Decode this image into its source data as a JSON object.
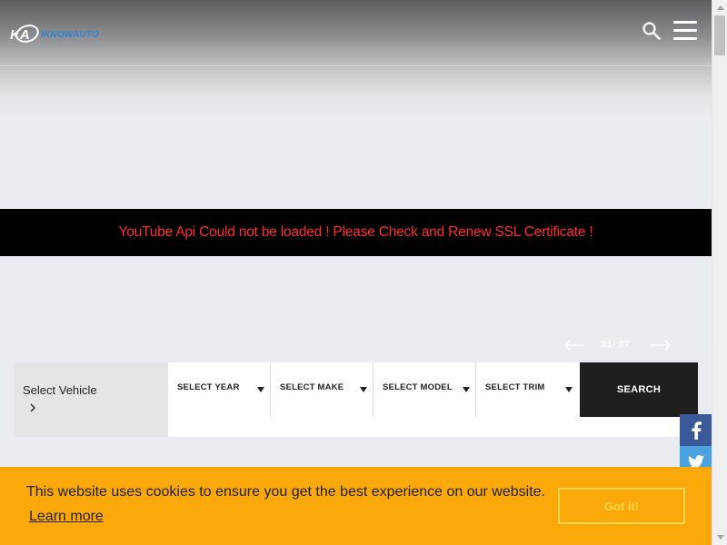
{
  "header": {
    "logo_text": "IKNOWAUTO",
    "logo_mark_icon": "ka-logo-icon",
    "search_icon": "search-icon",
    "menu_icon": "hamburger-menu-icon"
  },
  "banner": {
    "message": "YouTube Api Could not be loaded ! Please Check and Renew SSL Certificate !"
  },
  "pager": {
    "count": "01- 07",
    "prev_icon": "arrow-left-icon",
    "next_icon": "arrow-right-icon"
  },
  "vehicle_search": {
    "label": "Select Vehicle",
    "chevron_icon": "chevron-right-icon",
    "selects": [
      {
        "label": "SELECT YEAR"
      },
      {
        "label": "SELECT MAKE"
      },
      {
        "label": "SELECT MODEL"
      },
      {
        "label": "SELECT TRIM"
      }
    ],
    "search_label": "SEARCH"
  },
  "social": {
    "facebook_icon": "facebook-icon",
    "twitter_icon": "twitter-icon"
  },
  "cookie": {
    "message": "This website uses cookies to ensure you get the best experience on our website.",
    "learn_more": "Learn more",
    "accept": "Got it!"
  },
  "colors": {
    "accent_blue": "#2f84d9",
    "banner_text": "#ff2d2d",
    "cookie_bg": "#fba90a",
    "cookie_button": "#ffd54a",
    "facebook": "#3b5998",
    "twitter": "#4aa3df"
  }
}
